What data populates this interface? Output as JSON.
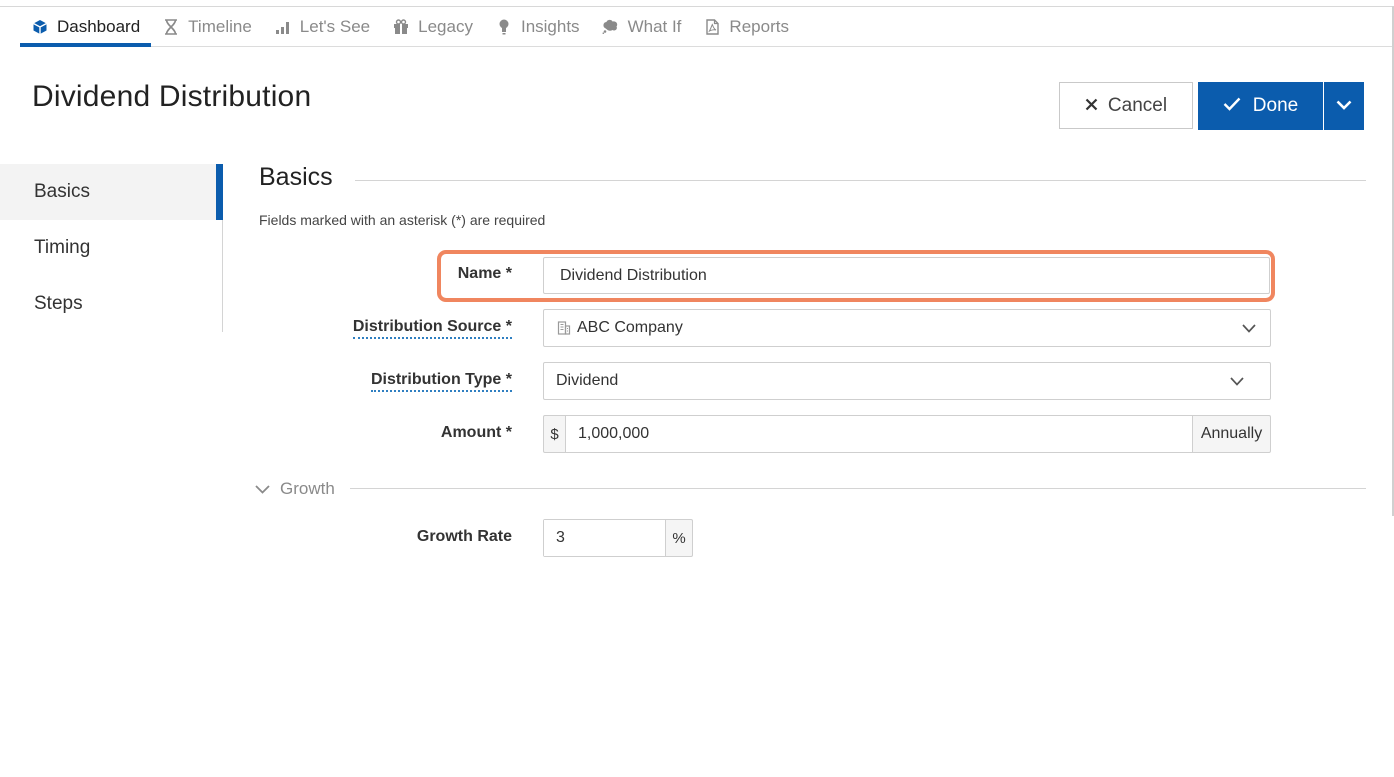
{
  "nav": {
    "items": [
      {
        "label": "Dashboard",
        "icon": "cube-icon",
        "active": true
      },
      {
        "label": "Timeline",
        "icon": "hourglass-icon",
        "active": false
      },
      {
        "label": "Let's See",
        "icon": "bar-chart-icon",
        "active": false
      },
      {
        "label": "Legacy",
        "icon": "gift-icon",
        "active": false
      },
      {
        "label": "Insights",
        "icon": "lightbulb-icon",
        "active": false
      },
      {
        "label": "What If",
        "icon": "brain-icon",
        "active": false
      },
      {
        "label": "Reports",
        "icon": "pdf-icon",
        "active": false
      }
    ]
  },
  "page": {
    "title": "Dividend Distribution"
  },
  "actions": {
    "cancel_label": "Cancel",
    "done_label": "Done"
  },
  "sidenav": {
    "items": [
      {
        "label": "Basics",
        "active": true
      },
      {
        "label": "Timing",
        "active": false
      },
      {
        "label": "Steps",
        "active": false
      }
    ]
  },
  "basics": {
    "title": "Basics",
    "required_note": "Fields marked with an asterisk (*) are required",
    "name": {
      "label": "Name *",
      "value": "Dividend Distribution"
    },
    "distribution_source": {
      "label": "Distribution Source *",
      "value": "ABC Company",
      "icon": "building-icon"
    },
    "distribution_type": {
      "label": "Distribution Type *",
      "value": "Dividend"
    },
    "amount": {
      "label": "Amount *",
      "prefix": "$",
      "value": "1,000,000",
      "frequency": "Annually"
    }
  },
  "growth": {
    "toggle_label": "Growth",
    "rate": {
      "label": "Growth Rate",
      "value": "3",
      "suffix": "%"
    }
  },
  "colors": {
    "accent": "#0b5cad",
    "highlight": "#f0865f"
  }
}
